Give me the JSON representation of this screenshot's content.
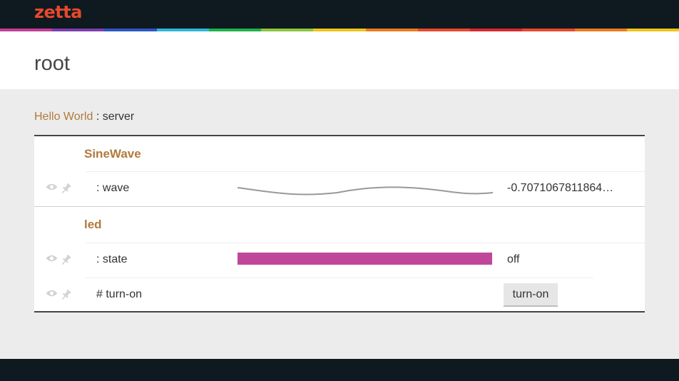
{
  "app": {
    "logo": "zetta"
  },
  "rainbow_colors": [
    "#c43d97",
    "#7b3fae",
    "#2f56c2",
    "#2fb7d6",
    "#1fb14a",
    "#8bc63f",
    "#f0c419",
    "#ec7b23",
    "#e8482c",
    "#d7282f",
    "#e8482c",
    "#ec7b23",
    "#f0c419"
  ],
  "page": {
    "title": "root"
  },
  "breadcrumb": {
    "link": "Hello World",
    "separator": " : server"
  },
  "devices": [
    {
      "name": "SineWave",
      "rows": [
        {
          "label": ": wave",
          "value": "-0.7071067811864…"
        }
      ]
    },
    {
      "name": "led",
      "rows": [
        {
          "label": ": state",
          "value": "off",
          "bar_color": "#c04699"
        },
        {
          "label": "# turn-on",
          "button": "turn-on"
        }
      ]
    }
  ],
  "colors": {
    "accent": "#b17a3c",
    "topbar": "#0e1a20",
    "logo": "#e8482c",
    "state_bar": "#c04699"
  }
}
